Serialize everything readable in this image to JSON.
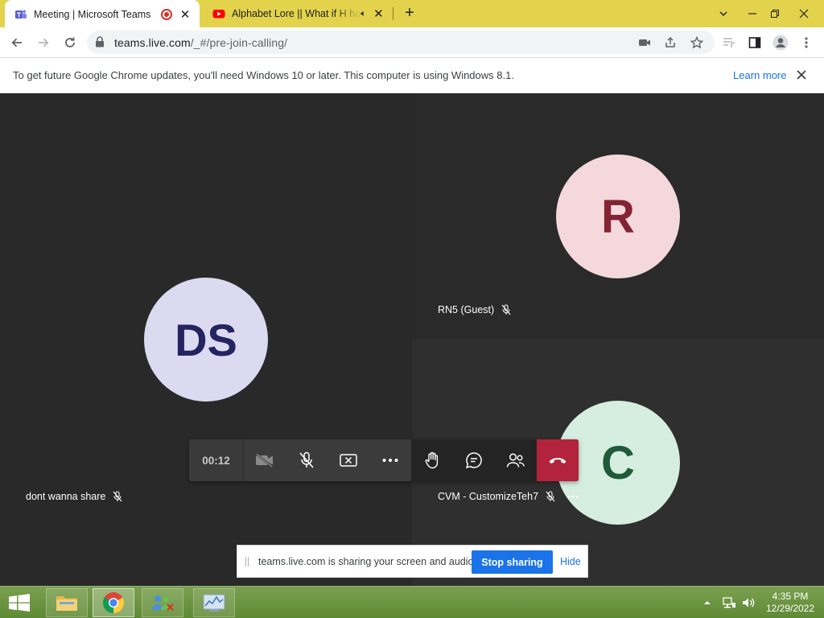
{
  "browser": {
    "tabs": [
      {
        "title": "Meeting | Microsoft Teams",
        "favicon": "teams-icon",
        "active": true
      },
      {
        "title": "Alphabet Lore || What if H had",
        "favicon": "youtube-icon",
        "active": false
      }
    ],
    "url_host": "teams.live.com",
    "url_path": "/_#/pre-join-calling/",
    "colors": {
      "tabstrip": "#e3d24b",
      "accent": "#1a73e8"
    }
  },
  "infobar": {
    "message": "To get future Google Chrome updates, you'll need Windows 10 or later. This computer is using Windows 8.1.",
    "learn_more": "Learn more"
  },
  "meeting": {
    "timer": "00:12",
    "participants": [
      {
        "initials": "DS",
        "name": "dont wanna share",
        "muted": true,
        "avatar_bg": "#dcdaf0",
        "avatar_fg": "#252461"
      },
      {
        "initials": "R",
        "name": "RN5 (Guest)",
        "muted": true,
        "avatar_bg": "#f5d8dc",
        "avatar_fg": "#832435"
      },
      {
        "initials": "C",
        "name": "CVM - CustomizeTeh7",
        "muted": true,
        "avatar_bg": "#d6eee0",
        "avatar_fg": "#1f5a3a"
      }
    ],
    "controls": [
      "camera-off",
      "mic-off",
      "share-screen",
      "more-options",
      "raise-hand",
      "chat",
      "people",
      "leave"
    ]
  },
  "share_banner": {
    "message": "teams.live.com is sharing your screen and audio.",
    "stop_label": "Stop sharing",
    "hide_label": "Hide"
  },
  "taskbar": {
    "time": "4:35 PM",
    "date": "12/29/2022",
    "apps": [
      "file-explorer",
      "chrome",
      "network-app",
      "task-manager"
    ]
  }
}
